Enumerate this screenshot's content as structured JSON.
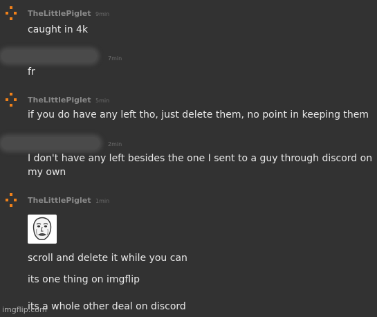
{
  "comments": [
    {
      "username": "TheLittlePiglet",
      "time": "9min",
      "text": "caught in 4k"
    },
    {
      "username": "",
      "time": "7min",
      "text": "fr"
    },
    {
      "username": "TheLittlePiglet",
      "time": "5min",
      "text": "if you do have any left tho, just delete them, no point in keeping them"
    },
    {
      "username": "",
      "time": "2min",
      "text": "I don't have any left besides the one I sent to a guy through discord on my own"
    },
    {
      "username": "TheLittlePiglet",
      "time": "1min",
      "image": "okay-guy-rage-face-meme-thumbnail",
      "lines": [
        "scroll and delete it while you can",
        "its one thing on imgflip",
        "its a whole other deal on discord"
      ]
    }
  ],
  "watermark": "imgflip.com",
  "colors": {
    "background": "#323232",
    "avatar_accent": "#f0811a",
    "username": "#8a8a8a",
    "text": "#e8e8e8"
  }
}
